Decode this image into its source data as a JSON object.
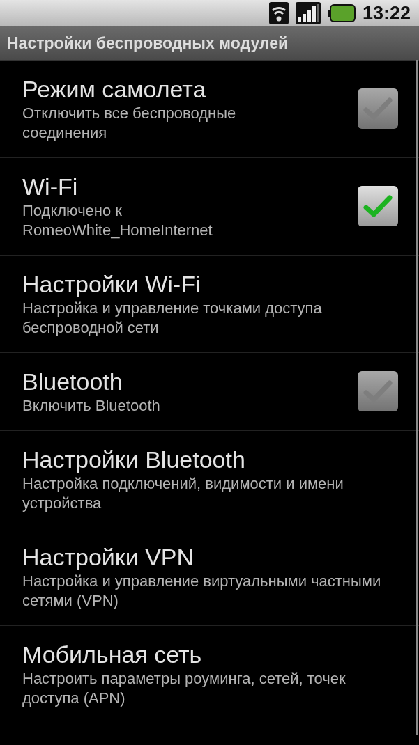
{
  "status_bar": {
    "time": "13:22"
  },
  "title_bar": {
    "title": "Настройки беспроводных модулей"
  },
  "items": [
    {
      "kind": "checkbox",
      "title": "Режим самолета",
      "summary": "Отключить все беспроводные соединения",
      "checked": false,
      "disabled": true
    },
    {
      "kind": "checkbox",
      "title": "Wi-Fi",
      "summary": "Подключено к RomeoWhite_HomeInternet",
      "checked": true,
      "disabled": false
    },
    {
      "kind": "link",
      "title": "Настройки Wi-Fi",
      "summary": "Настройка и управление точками доступа беспроводной сети"
    },
    {
      "kind": "checkbox",
      "title": "Bluetooth",
      "summary": "Включить Bluetooth",
      "checked": false,
      "disabled": true
    },
    {
      "kind": "link",
      "title": "Настройки Bluetooth",
      "summary": "Настройка подключений, видимости и имени устройства"
    },
    {
      "kind": "link",
      "title": "Настройки VPN",
      "summary": "Настройка и управление виртуальными частными сетями (VPN)"
    },
    {
      "kind": "link",
      "title": "Мобильная сеть",
      "summary": "Настроить параметры роуминга, сетей, точек доступа (APN)"
    }
  ]
}
